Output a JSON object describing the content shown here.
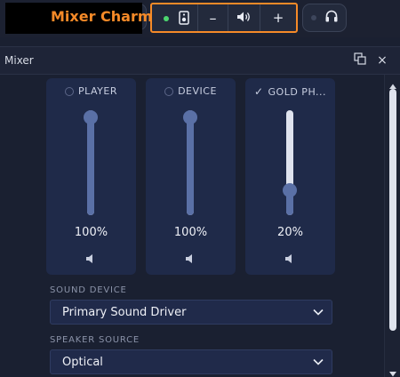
{
  "app": {
    "title": "Mixer Charm"
  },
  "charm_bar": {
    "status_color": "#4cd66f",
    "minus_label": "–",
    "plus_label": "+",
    "accent_color": "#f58a28"
  },
  "window": {
    "title": "Mixer",
    "close_label": "×"
  },
  "channels": [
    {
      "name": "PLAYER",
      "marker": "radio",
      "value_label": "100%",
      "level": 1.0
    },
    {
      "name": "DEVICE",
      "marker": "radio",
      "value_label": "100%",
      "level": 1.0
    },
    {
      "name": "GOLD PH...",
      "marker": "check",
      "check_glyph": "✓",
      "value_label": "20%",
      "level": 0.2
    }
  ],
  "sound_device": {
    "label": "SOUND DEVICE",
    "value": "Primary Sound Driver"
  },
  "speaker_source": {
    "label": "SPEAKER SOURCE",
    "value": "Optical"
  }
}
